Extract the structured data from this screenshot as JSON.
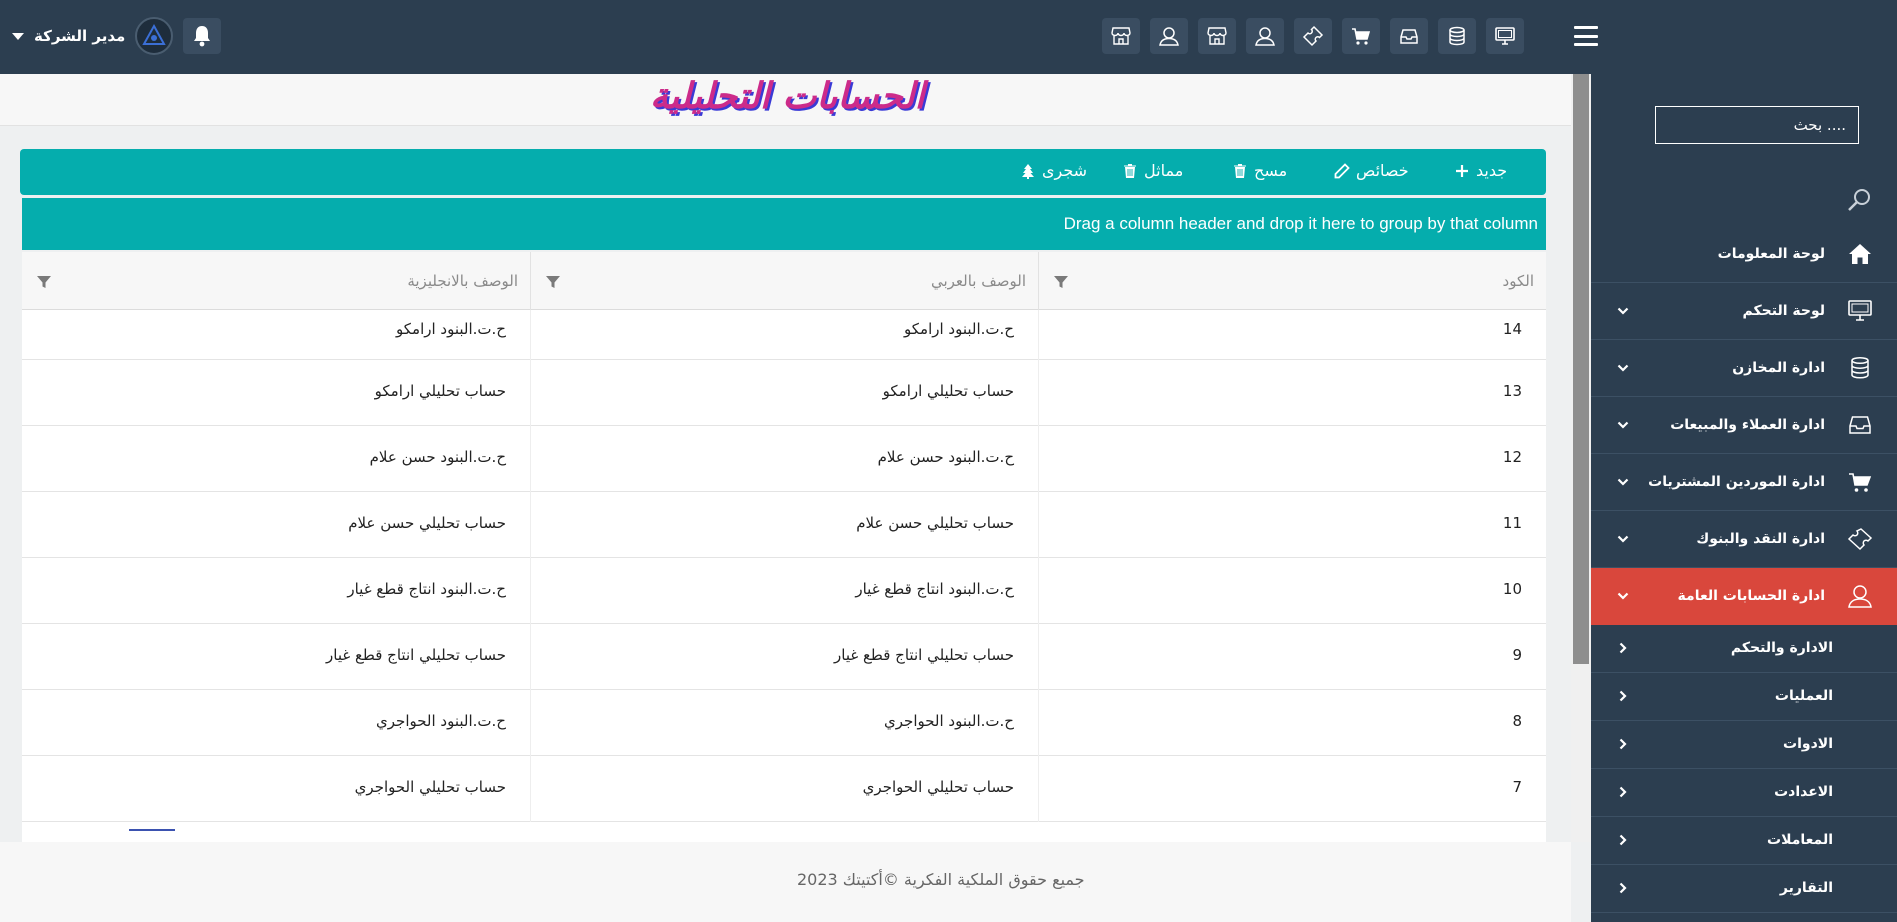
{
  "colors": {
    "header_bg": "#2c3e50",
    "accent_teal": "#05adad",
    "active_red": "#d9473c",
    "title_pink": "#cc2b8a",
    "title_shadow_blue": "#3a3ad6"
  },
  "header": {
    "user_name": "مدير الشركة",
    "tool_icons": [
      "monitor-icon",
      "database-icon",
      "inbox-icon",
      "cart-icon",
      "ticket-icon",
      "user-icon",
      "store-icon",
      "user-icon",
      "store-icon"
    ]
  },
  "sidebar": {
    "search_placeholder": "بحث ....",
    "items": [
      {
        "label": "لوحة المعلومات",
        "icon": "home-icon"
      },
      {
        "label": "لوحة التحكم",
        "icon": "monitor-icon"
      },
      {
        "label": "ادارة المخازن",
        "icon": "database-icon"
      },
      {
        "label": "ادارة العملاء والمبيعات",
        "icon": "inbox-icon"
      },
      {
        "label": "ادارة الموردين المشتريات",
        "icon": "cart-icon"
      },
      {
        "label": "ادارة النقد والبنوك",
        "icon": "ticket-icon"
      },
      {
        "label": "ادارة الحسابات العامة",
        "icon": "user-icon"
      }
    ],
    "sub_items": [
      {
        "label": "الادارة والتحكم"
      },
      {
        "label": "العمليات"
      },
      {
        "label": "الادوات"
      },
      {
        "label": "الاعدادت"
      },
      {
        "label": "المعاملات"
      },
      {
        "label": "التقارير"
      }
    ]
  },
  "main": {
    "page_title": "الحسابات التحليلية",
    "toolbar": {
      "new_label": "جديد",
      "properties_label": "خصائص",
      "delete_label": "مسح",
      "similar_label": "مماثل",
      "tree_label": "شجرى"
    },
    "group_panel_text": "Drag a column header and drop it here to group by that column",
    "grid": {
      "columns": [
        "الكود",
        "الوصف بالعربي",
        "الوصف بالانجليزية"
      ],
      "rows": [
        {
          "code": "14",
          "ar": "ح.ت.البنود ارامكو",
          "en": "ح.ت.البنود ارامكو"
        },
        {
          "code": "13",
          "ar": "حساب تحليلي ارامكو",
          "en": "حساب تحليلي ارامكو"
        },
        {
          "code": "12",
          "ar": "ح.ت.البنود حسن علام",
          "en": "ح.ت.البنود حسن علام"
        },
        {
          "code": "11",
          "ar": "حساب تحليلي حسن علام",
          "en": "حساب تحليلي حسن علام"
        },
        {
          "code": "10",
          "ar": "ح.ت.البنود انتاج قطع غيار",
          "en": "ح.ت.البنود انتاج قطع غيار"
        },
        {
          "code": "9",
          "ar": "حساب تحليلي انتاج قطع غيار",
          "en": "حساب تحليلي انتاج قطع غيار"
        },
        {
          "code": "8",
          "ar": "ح.ت.البنود الحواجري",
          "en": "ح.ت.البنود الحواجري"
        },
        {
          "code": "7",
          "ar": "حساب تحليلي الحواجري",
          "en": "حساب تحليلي الحواجري"
        }
      ]
    },
    "footer_text": "جميع حقوق الملكية الفكرية ©أكتيتك 2023"
  }
}
